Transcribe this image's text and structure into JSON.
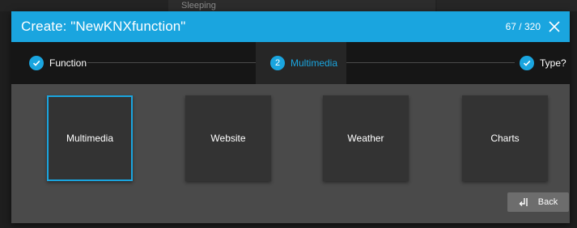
{
  "background": {
    "tile_text": "Sleeping"
  },
  "dialog": {
    "title": "Create: \"NewKNXfunction\"",
    "counter": "67 / 320",
    "close_icon": "close-icon"
  },
  "stepper": {
    "steps": [
      {
        "label": "Function",
        "state": "done",
        "icon": "check-icon"
      },
      {
        "label": "Multimedia",
        "state": "active",
        "number": "2"
      },
      {
        "label": "Type?",
        "state": "done",
        "icon": "check-icon"
      }
    ]
  },
  "options": [
    {
      "label": "Multimedia",
      "selected": true
    },
    {
      "label": "Website",
      "selected": false
    },
    {
      "label": "Weather",
      "selected": false
    },
    {
      "label": "Charts",
      "selected": false
    }
  ],
  "back_button": {
    "label": "Back",
    "icon": "return-arrow-icon"
  },
  "colors": {
    "accent": "#1aa5df",
    "panel": "#4a4a4a",
    "tile": "#333333",
    "stepper": "#161616"
  }
}
